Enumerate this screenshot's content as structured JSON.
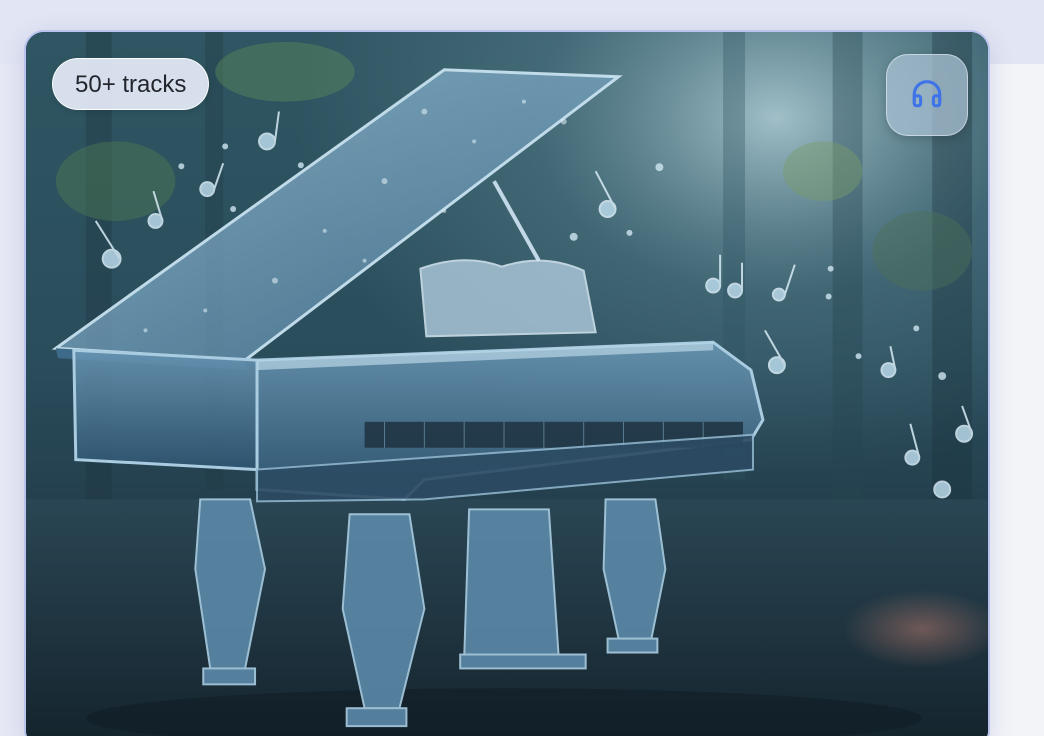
{
  "card": {
    "badge_label": "50+ tracks",
    "audio_button_icon": "headphones-icon",
    "image_subject": "crystal-grand-piano-with-music-notes"
  },
  "colors": {
    "card_border": "#b9c3ee",
    "icon_accent": "#3f74e8",
    "badge_bg": "#e2e8f4",
    "badge_text": "#24262e"
  }
}
